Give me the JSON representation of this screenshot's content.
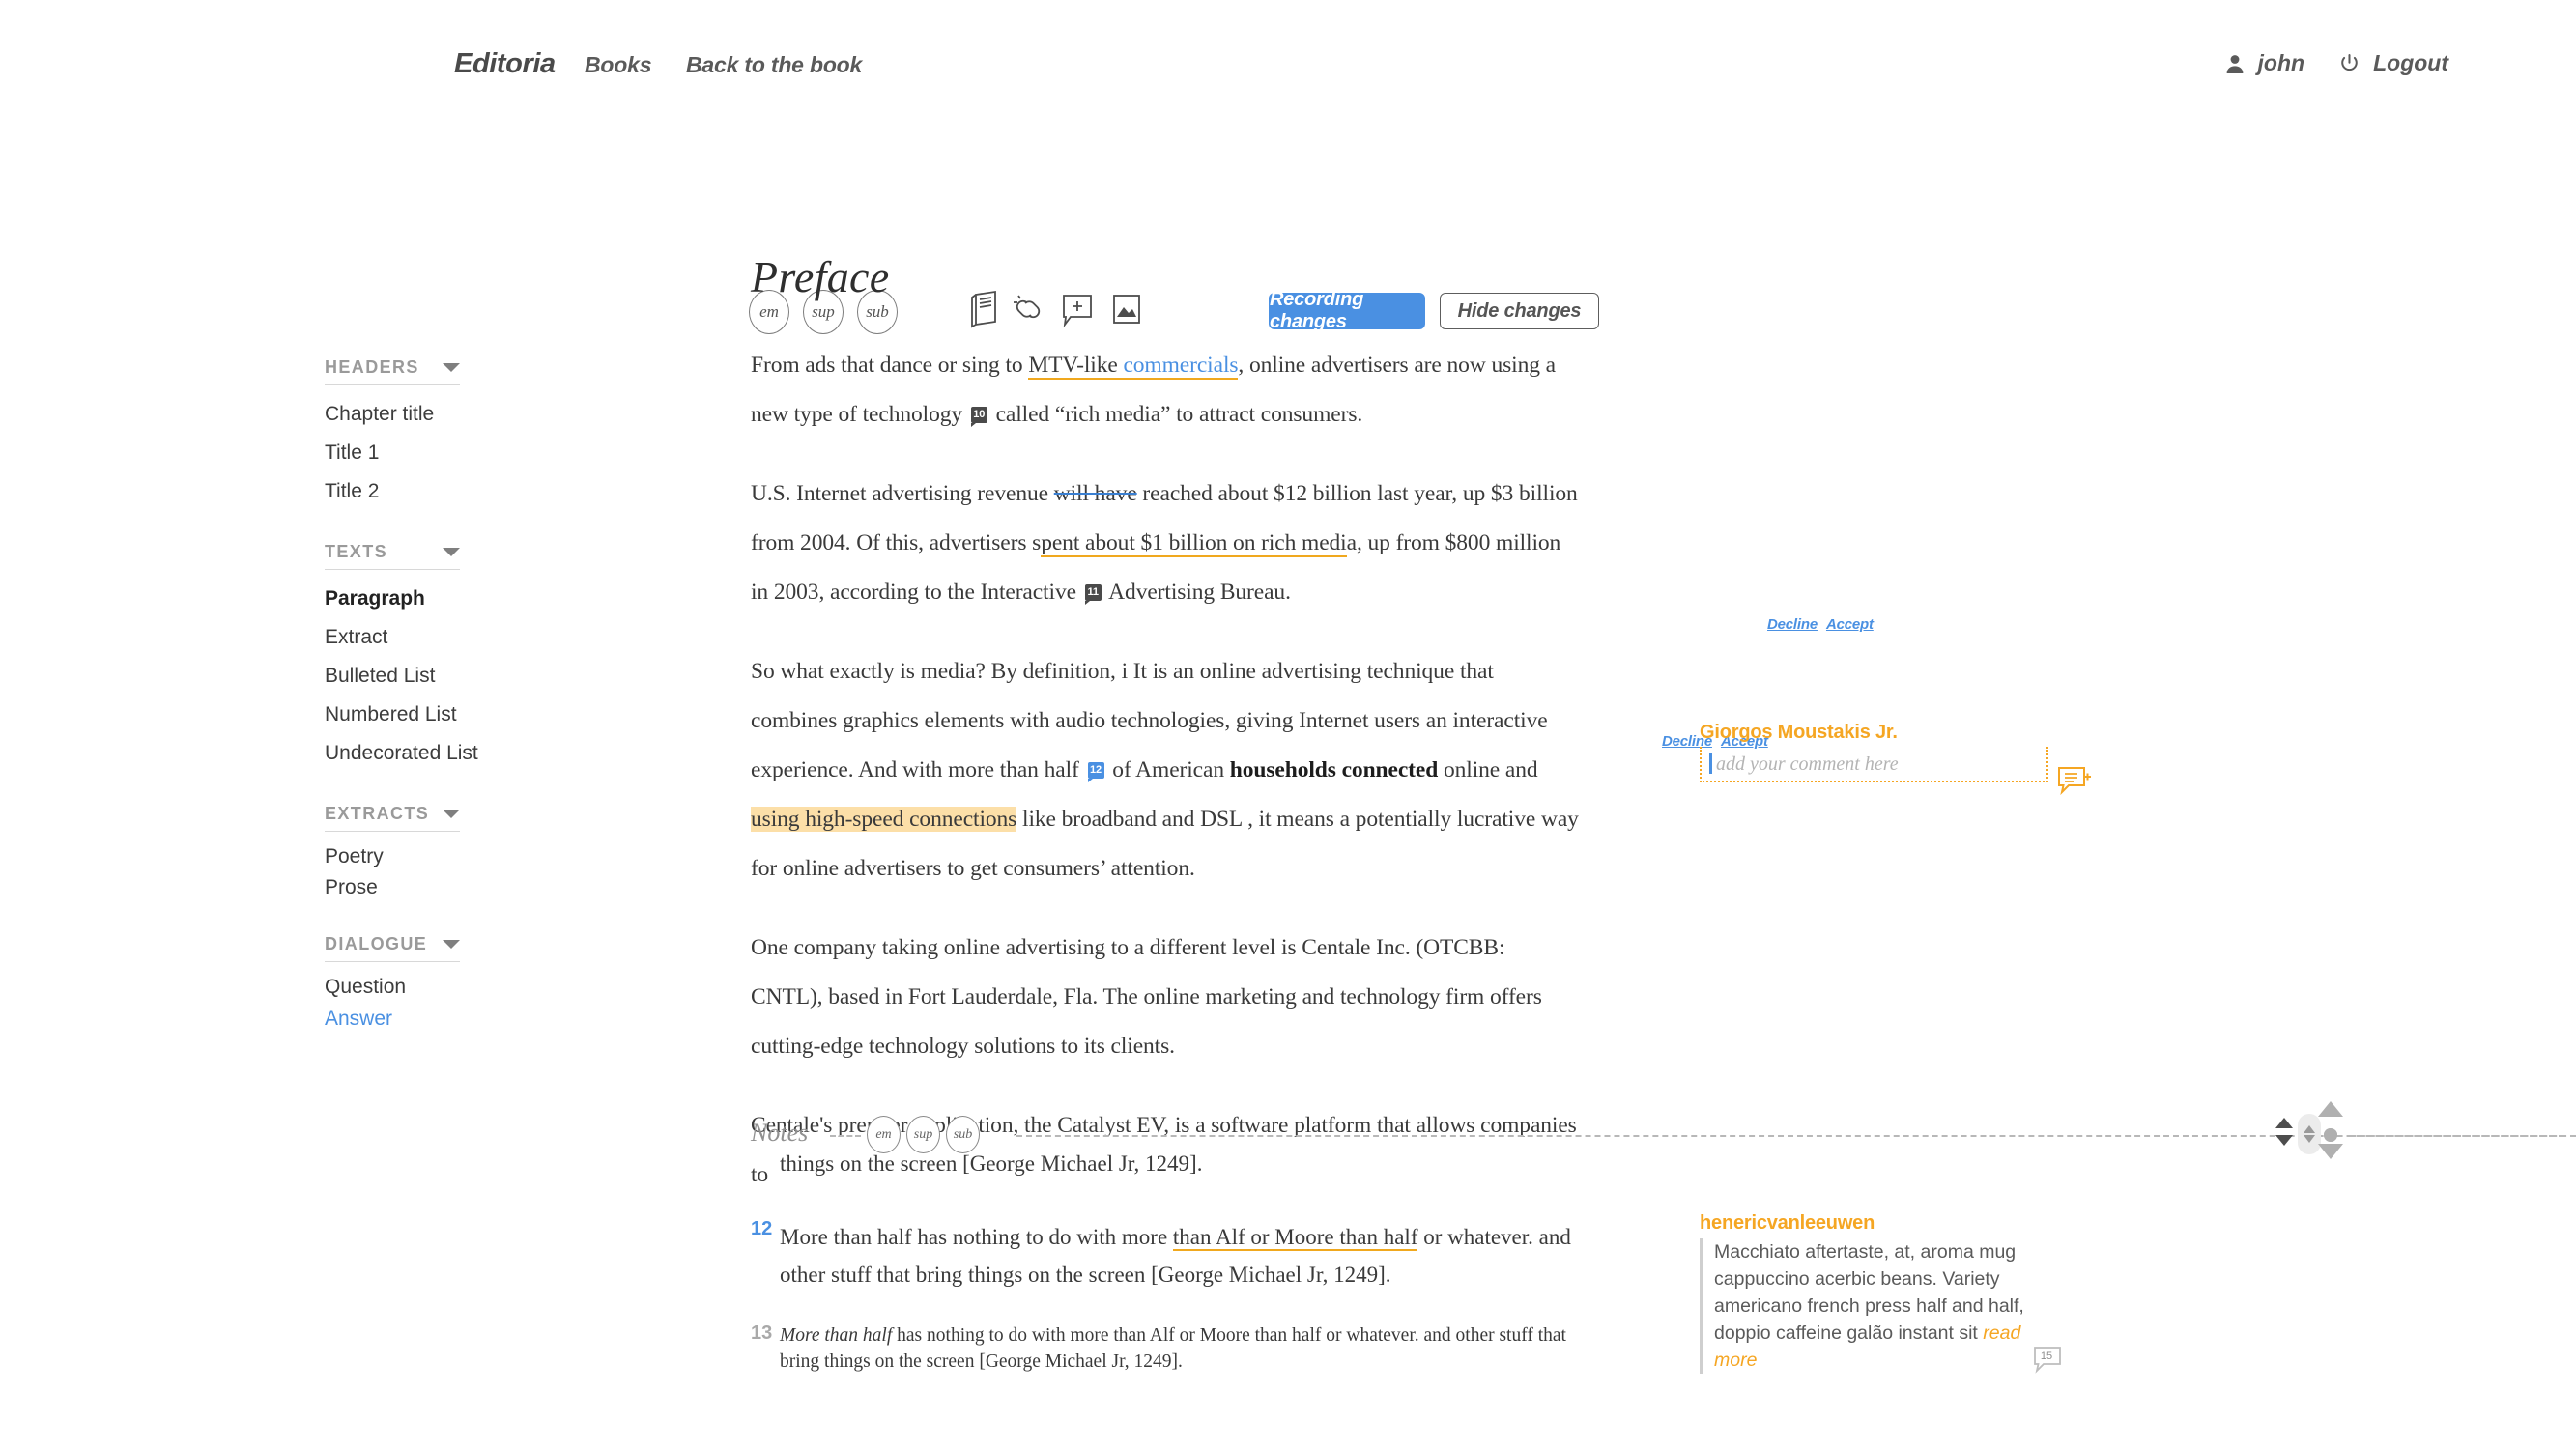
{
  "nav": {
    "brand": "Editoria",
    "books": "Books",
    "back": "Back to the book",
    "user_icon": "user-icon",
    "username": "john",
    "power_icon": "power-icon",
    "logout": "Logout"
  },
  "toolbar": {
    "em": "em",
    "sup": "sup",
    "sub": "sub",
    "book_icon": "book-icon",
    "link_icon": "link-icon",
    "note_icon": "note-add-icon",
    "image_icon": "image-icon",
    "recording_changes": "Recording changes",
    "hide_changes": "Hide changes",
    "accent_blue": "#4a90e2"
  },
  "sidebar": {
    "groups": [
      {
        "title": "HEADERS",
        "items": [
          {
            "label": "Chapter title",
            "state": "normal"
          },
          {
            "label": "Title 1",
            "state": "normal"
          },
          {
            "label": "Title 2",
            "state": "normal"
          }
        ]
      },
      {
        "title": "TEXTS",
        "items": [
          {
            "label": "Paragraph",
            "state": "active"
          },
          {
            "label": "Extract",
            "state": "normal"
          },
          {
            "label": "Bulleted List",
            "state": "normal"
          },
          {
            "label": "Numbered List",
            "state": "normal"
          },
          {
            "label": "Undecorated List",
            "state": "normal"
          }
        ]
      },
      {
        "title": "EXTRACTS",
        "items": [
          {
            "label": "Poetry",
            "state": "normal"
          },
          {
            "label": "Prose",
            "state": "normal"
          }
        ]
      },
      {
        "title": "DIALOGUE",
        "items": [
          {
            "label": "Question",
            "state": "normal"
          },
          {
            "label": "Answer",
            "state": "link"
          }
        ]
      }
    ]
  },
  "document": {
    "title": "Preface",
    "p1": {
      "a": "From ads that dance or sing to ",
      "ins_underline": "MTV-like ",
      "ins_link": "commercials",
      "b": ", online advertisers are now using a new type of technology ",
      "note_marker": "10",
      "c": " called “rich media” to attract consumers.",
      "decline": "Decline",
      "accept": "Accept"
    },
    "p2": {
      "a": "U.S. Internet advertising revenue ",
      "deleted": "will have",
      "b": " reached about $12 billion last year, up $3 billion from 2004. Of this, advertisers s",
      "underlined": "pent about $1 billion on rich medi",
      "c": "a, up from $800 million  in 2003, according to the Interactive ",
      "note_marker": "11",
      "d": " Advertising Bureau.",
      "decline": "Decline",
      "accept": "Accept"
    },
    "p3": {
      "a": "So what exactly is media? By definition, i It is an online advertising technique that combines graphics elements with audio technologies, giving Internet users an interactive experience. And with more than half ",
      "note_marker": "12",
      "b": " of American ",
      "bold": "households connected",
      "c": " online and ",
      "highlight": "using high-speed connections",
      "d": " like broadband and DSL , it means a potentially lucrative way for online advertisers to get consumers’ attention."
    },
    "p4": "One company taking online advertising to a different level is Centale Inc. (OTCBB: CNTL), based in Fort Lauderdale, Fla. The online marketing and technology firm offers cutting-edge technology solutions to its clients.",
    "p5": "Centale's premier application, the Catalyst EV, is a software platform that allows companies to"
  },
  "notes_divider": {
    "label": "Notes",
    "em": "em",
    "sup": "sup",
    "sub": "sub"
  },
  "notes": {
    "cut_off_line": "things on the screen [George Michael Jr, 1249].",
    "items": [
      {
        "number": "12",
        "color": "blue",
        "a": "More than half has nothing to do with more ",
        "underlined": "than Alf or Moore than half",
        "b": " or whatever. and other stuff that bring things on the screen [George Michael Jr, 1249]."
      },
      {
        "number": "13",
        "color": "grey",
        "italic_lead": "More than half",
        "rest": " has nothing to do with more than Alf or Moore than half or whatever. and other stuff that bring things on the screen [George Michael Jr, 1249]."
      }
    ]
  },
  "comments": [
    {
      "author": "Giorgos Moustakis Jr.",
      "placeholder": "add your comment here",
      "bubble_icon": "comment-add-icon",
      "accent": "#f5a623"
    },
    {
      "author": "henericvanleeuwen",
      "text": "Macchiato aftertaste, at, aroma mug cappuccino acerbic beans. Variety americano french press half and half, doppio caffeine galão instant sit ",
      "read_more": "read more",
      "count": "15",
      "count_icon": "comment-count-icon",
      "accent": "#f5a623"
    }
  ],
  "rail": {
    "handle_up_icon": "chevron-up-icon",
    "handle_down_icon": "chevron-down-icon",
    "drag_pill_icon": "drag-handle-icon"
  }
}
